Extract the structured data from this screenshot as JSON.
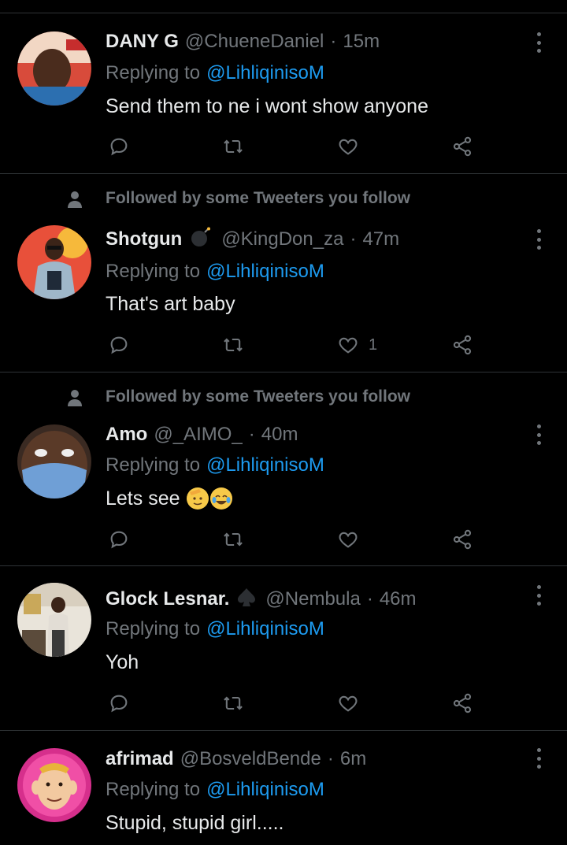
{
  "reply_prefix": "Replying to",
  "social_context_text": "Followed by some Tweeters you follow",
  "colors": {
    "background": "#000000",
    "text": "#e7e9ea",
    "muted": "#71767b",
    "link": "#1d9bf0",
    "divider": "#2f3336"
  },
  "icons": [
    "comment-icon",
    "retweet-icon",
    "like-icon",
    "share-icon",
    "more-options-icon",
    "person-icon"
  ],
  "tweets": [
    {
      "name": "DANY G",
      "handle": "@ChueneDaniel",
      "separator": "·",
      "time": "15m",
      "reply_to": "@LihliqinisoM",
      "text": "Send them to ne i wont show anyone",
      "like_count": ""
    },
    {
      "name": "Shotgun",
      "badge": "bomb-emoji",
      "handle": "@KingDon_za",
      "separator": "·",
      "time": "47m",
      "reply_to": "@LihliqinisoM",
      "text": "That's art baby",
      "like_count": "1"
    },
    {
      "name": "Amo",
      "handle": "@_AIMO_",
      "separator": "·",
      "time": "40m",
      "reply_to": "@LihliqinisoM",
      "text": "Lets see",
      "emojis": [
        "saluting-face-emoji",
        "laughing-crying-emoji"
      ],
      "like_count": ""
    },
    {
      "name": "Glock Lesnar.",
      "badge": "spade-emoji",
      "handle": "@Nembula",
      "separator": "·",
      "time": "46m",
      "reply_to": "@LihliqinisoM",
      "text": "Yoh",
      "like_count": ""
    },
    {
      "name": "afrimad",
      "handle": "@BosveldBende",
      "separator": "·",
      "time": "6m",
      "reply_to": "@LihliqinisoM",
      "text": "Stupid, stupid girl.....",
      "like_count": ""
    }
  ]
}
